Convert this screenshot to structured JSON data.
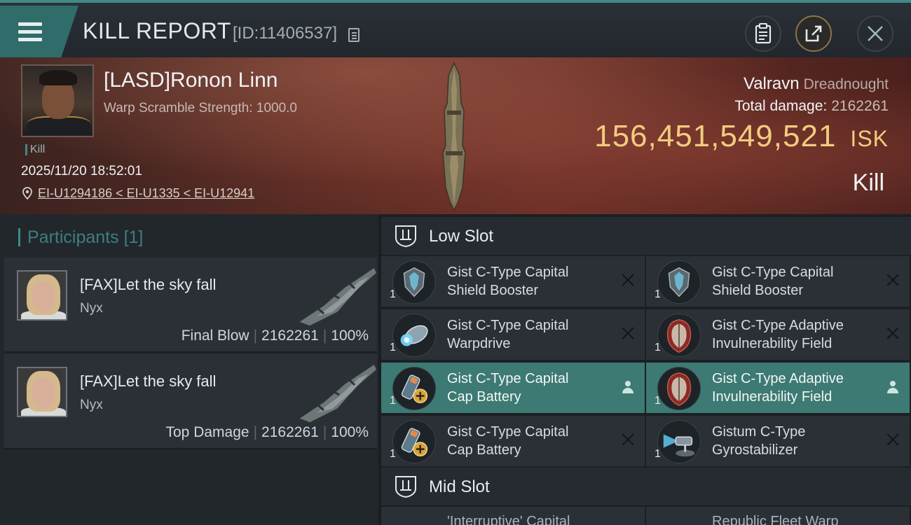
{
  "header": {
    "title": "KILL REPORT",
    "report_id": "[ID:11406537]",
    "icons": {
      "menu": "hamburger-menu-icon",
      "copy": "copy-icon",
      "log": "clipboard-icon",
      "share": "share-icon",
      "close": "close-icon"
    }
  },
  "victim": {
    "name": "[LASD]Ronon Linn",
    "warp_scramble": "Warp Scramble Strength: 1000.0",
    "tag": "Kill",
    "time": "2025/11/20 18:52:01",
    "location": "EI-U1294186 < EI-U1335 < EI-U12941",
    "ship": "Valravn",
    "ship_class": "Dreadnought",
    "total_damage_label": "Total damage:",
    "total_damage": "2162261",
    "isk_value": "156,451,549,521",
    "isk_unit": "ISK",
    "result": "Kill"
  },
  "participants": {
    "heading": "Participants",
    "count": "[1]",
    "items": [
      {
        "name": "[FAX]Let the sky fall",
        "ship": "Nyx",
        "role": "Final Blow",
        "damage": "2162261",
        "percent": "100%"
      },
      {
        "name": "[FAX]Let the sky fall",
        "ship": "Nyx",
        "role": "Top Damage",
        "damage": "2162261",
        "percent": "100%"
      }
    ]
  },
  "fitting": {
    "low_slot_label": "Low Slot",
    "mid_slot_label": "Mid Slot",
    "modules": [
      {
        "qty": "1",
        "line1": "Gist C-Type Capital",
        "line2": "Shield Booster",
        "icon": "shield-booster-icon",
        "highlight": false
      },
      {
        "qty": "1",
        "line1": "Gist C-Type Capital",
        "line2": "Shield Booster",
        "icon": "shield-booster-icon",
        "highlight": false
      },
      {
        "qty": "1",
        "line1": "Gist C-Type Capital",
        "line2": "Warpdrive",
        "icon": "warpdrive-icon",
        "highlight": false
      },
      {
        "qty": "1",
        "line1": "Gist C-Type Adaptive",
        "line2": "Invulnerability Field",
        "icon": "invulnerability-field-icon",
        "highlight": false
      },
      {
        "qty": "1",
        "line1": "Gist C-Type Capital",
        "line2": "Cap Battery",
        "icon": "cap-battery-icon",
        "highlight": true
      },
      {
        "qty": "1",
        "line1": "Gist C-Type Adaptive",
        "line2": "Invulnerability Field",
        "icon": "invulnerability-field-icon",
        "highlight": true
      },
      {
        "qty": "1",
        "line1": "Gist C-Type Capital",
        "line2": "Cap Battery",
        "icon": "cap-battery-icon",
        "highlight": false
      },
      {
        "qty": "1",
        "line1": "Gistum C-Type",
        "line2": "Gyrostabilizer",
        "icon": "gyrostabilizer-icon",
        "highlight": false
      }
    ],
    "mid_peek": [
      "'Interruptive' Capital",
      "Republic Fleet Warp"
    ]
  },
  "colors": {
    "accent": "#3f8a86",
    "isk": "#f2cc7e",
    "highlight_row": "#3c7a73"
  }
}
